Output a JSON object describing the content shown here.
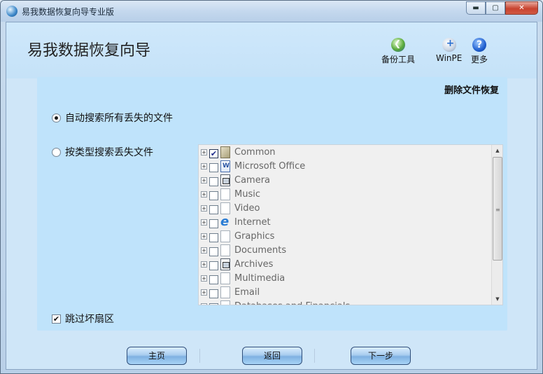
{
  "window": {
    "title": "易我数据恢复向导专业版",
    "min_glyph": "▬",
    "max_glyph": "▢",
    "close_glyph": "✕"
  },
  "header": {
    "app_title": "易我数据恢复向导",
    "tools": [
      {
        "label": "备份工具",
        "icon": "backup-icon"
      },
      {
        "label": "WinPE",
        "icon": "winpe-icon"
      },
      {
        "label": "更多",
        "icon": "help-icon",
        "glyph": "?"
      }
    ]
  },
  "panel": {
    "section_label": "删除文件恢复",
    "option_auto": "自动搜索所有丢失的文件",
    "option_by_type": "按类型搜索丢失文件",
    "skip_bad_sectors": "跳过坏扇区",
    "checkmark_glyph": "✔",
    "selected_option": "auto",
    "skip_checked": true
  },
  "tree": {
    "expand_glyph": "+",
    "items": [
      {
        "label": "Common",
        "checked": true,
        "icon": "cube"
      },
      {
        "label": "Microsoft Office",
        "checked": false,
        "icon": "doc-word"
      },
      {
        "label": "Camera",
        "checked": false,
        "icon": "cam"
      },
      {
        "label": "Music",
        "checked": false,
        "icon": "file"
      },
      {
        "label": "Video",
        "checked": false,
        "icon": "file"
      },
      {
        "label": "Internet",
        "checked": false,
        "icon": "ie"
      },
      {
        "label": "Graphics",
        "checked": false,
        "icon": "file"
      },
      {
        "label": "Documents",
        "checked": false,
        "icon": "file"
      },
      {
        "label": "Archives",
        "checked": false,
        "icon": "cam"
      },
      {
        "label": "Multimedia",
        "checked": false,
        "icon": "file"
      },
      {
        "label": "Email",
        "checked": false,
        "icon": "file"
      },
      {
        "label": "Databases and Financials",
        "checked": false,
        "icon": "file"
      }
    ],
    "scroll_up": "▲",
    "scroll_down": "▼",
    "grip": "≡"
  },
  "footer": {
    "home": "主页",
    "back": "返回",
    "next": "下一步"
  }
}
